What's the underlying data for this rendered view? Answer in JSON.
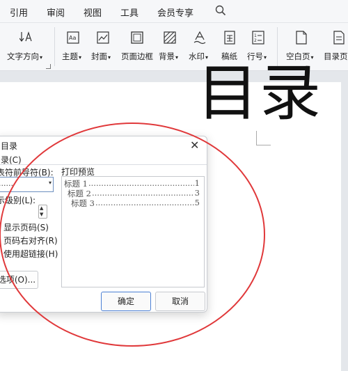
{
  "menubar": {
    "items": [
      "引用",
      "审阅",
      "视图",
      "工具",
      "会员专享"
    ]
  },
  "ribbon": {
    "items": [
      {
        "label": "文字方向",
        "icon": "text-direction-icon"
      },
      {
        "label": "主题",
        "icon": "theme-icon"
      },
      {
        "label": "封面",
        "icon": "cover-icon"
      },
      {
        "label": "页面边框",
        "icon": "page-border-icon"
      },
      {
        "label": "背景",
        "icon": "background-icon"
      },
      {
        "label": "水印",
        "icon": "watermark-icon"
      },
      {
        "label": "稿纸",
        "icon": "manuscript-icon"
      },
      {
        "label": "行号",
        "icon": "line-number-icon"
      },
      {
        "label": "空白页",
        "icon": "blank-page-icon"
      },
      {
        "label": "目录页",
        "icon": "toc-page-icon"
      }
    ]
  },
  "document": {
    "title": "目录"
  },
  "dialog": {
    "title": "目录",
    "tab": "录(C)",
    "leader_label": "表符前导符(B):",
    "leader_value": "......",
    "level_label": "示级别(L):",
    "show_page_numbers": "显示页码(S)",
    "right_align": "页码右对齐(R)",
    "use_hyperlinks": "使用超链接(H)",
    "options_button": "选项(O)...",
    "preview_label": "打印预览",
    "preview_lines": [
      {
        "text": "标题 1",
        "dots": "........................................................................",
        "page": "1"
      },
      {
        "text": "标题 2",
        "dots": "........................................................................",
        "page": "3"
      },
      {
        "text": "标题 3",
        "dots": "........................................................................",
        "page": "5"
      }
    ],
    "ok_button": "确定",
    "cancel_button": "取消"
  },
  "colors": {
    "annotation_circle": "#e0383a",
    "primary_border": "#4a7fd4"
  }
}
